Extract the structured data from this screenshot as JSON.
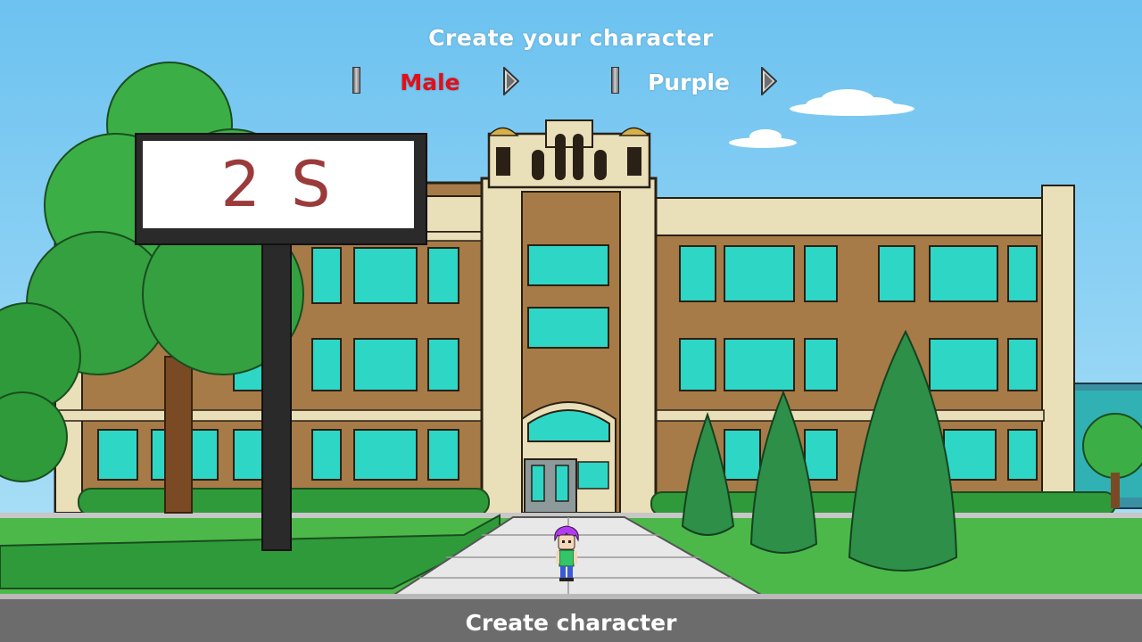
{
  "header": {
    "title": "Create your character"
  },
  "selectors": {
    "gender": {
      "value": "Male",
      "color": "#e0101a"
    },
    "hair_color": {
      "value": "Purple",
      "color": "#ffffff"
    }
  },
  "sign": {
    "text": "2 S"
  },
  "footer": {
    "create_label": "Create character"
  },
  "icons": {
    "prev": "arrow-left-icon",
    "next": "arrow-right-icon"
  },
  "colors": {
    "sky": "#7cc8f0",
    "brick": "#a67b48",
    "window": "#2ed6c6",
    "grass": "#4cb84a",
    "road": "#6c6c6c"
  }
}
